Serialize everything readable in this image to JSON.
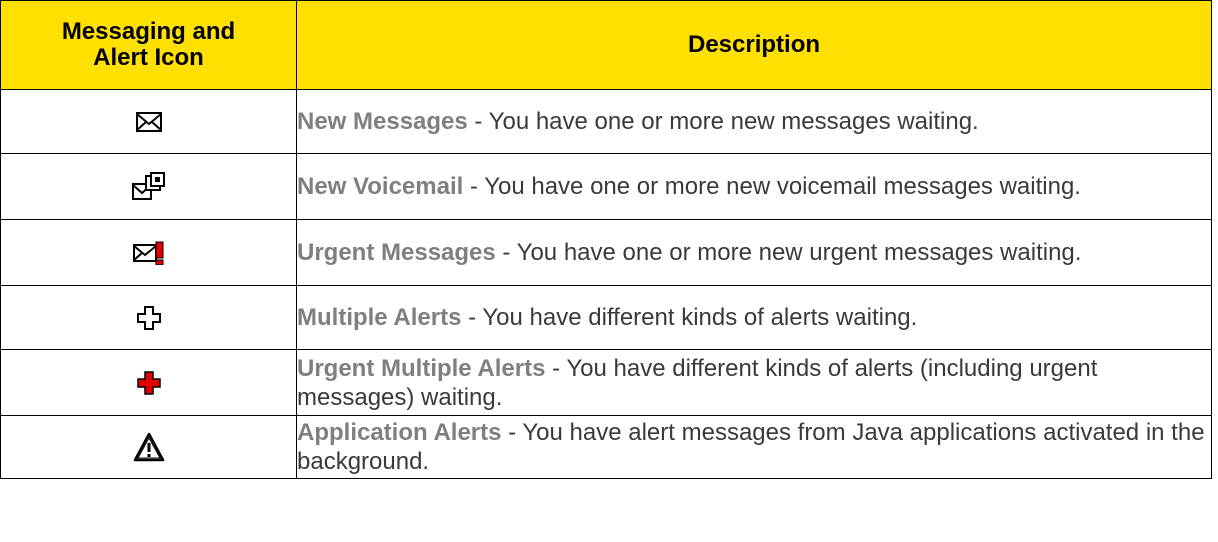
{
  "header": {
    "col1_line1": "Messaging and",
    "col1_line2": "Alert Icon",
    "col2": "Description"
  },
  "colors": {
    "header_bg": "#FFE000",
    "title_text": "#7F7F7F",
    "urgent_red": "#E00000"
  },
  "rows": [
    {
      "icon": "envelope-icon",
      "title": "New Messages",
      "text": " - You have one or more new messages waiting."
    },
    {
      "icon": "voicemail-envelope-icon",
      "title": "New Voicemail",
      "text": " - You have one or more new voicemail messages waiting."
    },
    {
      "icon": "urgent-envelope-icon",
      "title": "Urgent Messages",
      "text": " - You have one or more new urgent messages waiting."
    },
    {
      "icon": "outline-cross-icon",
      "title": "Multiple Alerts",
      "text": " - You have different kinds of alerts waiting."
    },
    {
      "icon": "red-cross-icon",
      "title": "Urgent Multiple Alerts",
      "text": " - You have different kinds of alerts (including urgent messages) waiting."
    },
    {
      "icon": "warning-triangle-icon",
      "title": "Application Alerts",
      "text": " - You have alert messages from Java applications activated in the background."
    }
  ]
}
